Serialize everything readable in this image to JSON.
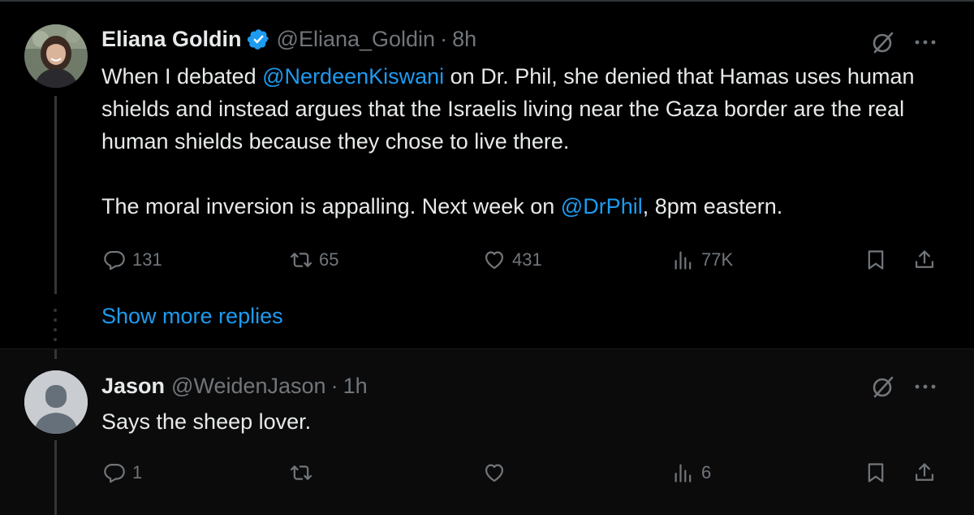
{
  "tweet1": {
    "name": "Eliana Goldin",
    "handle": "@Eliana_Goldin",
    "separator": "·",
    "time": "8h",
    "verified": true,
    "body_parts": {
      "p1_a": "When I debated ",
      "p1_mention": "@NerdeenKiswani",
      "p1_b": " on Dr. Phil, she denied that Hamas uses human shields and instead argues that the Israelis living near the Gaza border are the real human shields because they chose to live there.",
      "p2_a": "The moral inversion is appalling. Next week on ",
      "p2_mention": "@DrPhil",
      "p2_b": ", 8pm eastern."
    },
    "stats": {
      "replies": "131",
      "reposts": "65",
      "likes": "431",
      "views": "77K"
    }
  },
  "show_more_replies": "Show more replies",
  "tweet2": {
    "name": "Jason",
    "handle": "@WeidenJason",
    "separator": "·",
    "time": "1h",
    "body": "Says the sheep lover.",
    "stats": {
      "replies": "1",
      "reposts": "",
      "likes": "",
      "views": "6"
    }
  },
  "colors": {
    "background": "#000000",
    "reply_background": "#0b0b0b",
    "text": "#e7e9ea",
    "muted": "#71767b",
    "accent": "#1d9bf0",
    "verified_badge": "#1d9bf0"
  },
  "icons": [
    "verified-badge-icon",
    "grok-icon",
    "more-icon",
    "reply-icon",
    "repost-icon",
    "like-icon",
    "views-icon",
    "bookmark-icon",
    "share-icon"
  ]
}
